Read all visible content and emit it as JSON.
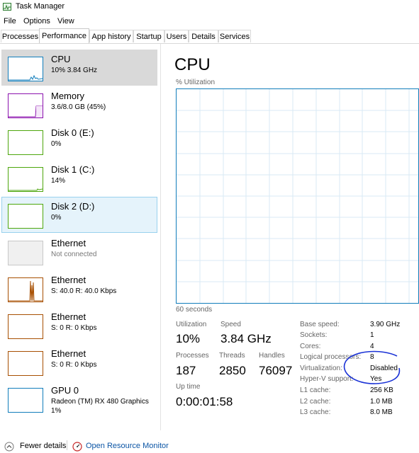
{
  "window": {
    "title": "Task Manager"
  },
  "menu": [
    "File",
    "Options",
    "View"
  ],
  "tabs": [
    "Processes",
    "Performance",
    "App history",
    "Startup",
    "Users",
    "Details",
    "Services"
  ],
  "active_tab": "Performance",
  "resources": [
    {
      "name": "CPU",
      "detail": "10%  3.84 GHz",
      "color": "#117dbb"
    },
    {
      "name": "Memory",
      "detail": "3.6/8.0 GB (45%)",
      "color": "#8b12ae"
    },
    {
      "name": "Disk 0 (E:)",
      "detail": "0%",
      "color": "#4da60c"
    },
    {
      "name": "Disk 1 (C:)",
      "detail": "14%",
      "color": "#4da60c"
    },
    {
      "name": "Disk 2 (D:)",
      "detail": "0%",
      "color": "#4da60c"
    },
    {
      "name": "Ethernet",
      "detail": "Not connected",
      "color": "#a8a8a8"
    },
    {
      "name": "Ethernet",
      "detail": "S: 40.0  R: 40.0 Kbps",
      "color": "#a74f01"
    },
    {
      "name": "Ethernet",
      "detail": "S: 0  R: 0 Kbps",
      "color": "#a74f01"
    },
    {
      "name": "Ethernet",
      "detail": "S: 0  R: 0 Kbps",
      "color": "#a74f01"
    },
    {
      "name": "GPU 0",
      "detail": "Radeon (TM) RX 480 Graphics",
      "detail2": "1%",
      "color": "#117dbb"
    }
  ],
  "cpu": {
    "heading": "CPU",
    "graph_label": "% Utilization",
    "time_label": "60 seconds",
    "stats": {
      "utilization_label": "Utilization",
      "utilization": "10%",
      "speed_label": "Speed",
      "speed": "3.84 GHz",
      "processes_label": "Processes",
      "processes": "187",
      "threads_label": "Threads",
      "threads": "2850",
      "handles_label": "Handles",
      "handles": "76097",
      "uptime_label": "Up time",
      "uptime": "0:00:01:58"
    },
    "info": [
      {
        "label": "Base speed:",
        "value": "3.90 GHz"
      },
      {
        "label": "Sockets:",
        "value": "1"
      },
      {
        "label": "Cores:",
        "value": "4"
      },
      {
        "label": "Logical processors:",
        "value": "8"
      },
      {
        "label": "Virtualization:",
        "value": "Disabled"
      },
      {
        "label": "Hyper-V support:",
        "value": "Yes"
      },
      {
        "label": "L1 cache:",
        "value": "256 KB"
      },
      {
        "label": "L2 cache:",
        "value": "1.0 MB"
      },
      {
        "label": "L3 cache:",
        "value": "8.0 MB"
      }
    ]
  },
  "footer": {
    "fewer_details": "Fewer details",
    "open_resource_monitor": "Open Resource Monitor"
  },
  "colors": {
    "graph_border": "#117dbb",
    "graph_grid": "#d9eaf4",
    "annotation": "#1a32d6",
    "link": "#0b55a5"
  }
}
